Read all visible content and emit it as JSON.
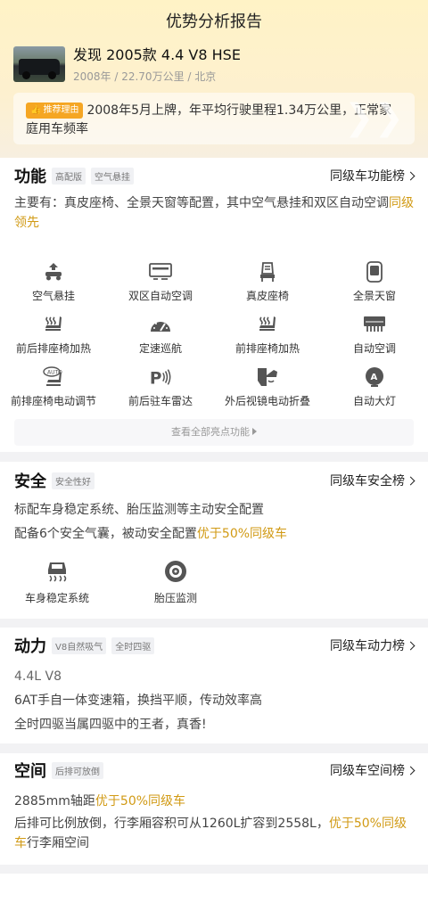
{
  "header": {
    "title": "优势分析报告"
  },
  "car": {
    "name": "发现 2005款 4.4 V8 HSE",
    "sub": "2008年 / 22.70万公里 / 北京"
  },
  "reason": {
    "badge": "推荐理由",
    "text": "2008年5月上牌，年平均行驶里程1.34万公里，正常家庭用车频率"
  },
  "function": {
    "title": "功能",
    "tags": [
      "高配版",
      "空气悬挂"
    ],
    "link": "同级车功能榜",
    "desc_main": "主要有：真皮座椅、全景天窗等配置，其中空气悬挂和双区自动空调",
    "desc_hl": "同级领先",
    "features": [
      {
        "icon": "air-suspension-icon",
        "label": "空气悬挂"
      },
      {
        "icon": "dual-zone-ac-icon",
        "label": "双区自动空调"
      },
      {
        "icon": "leather-seat-icon",
        "label": "真皮座椅"
      },
      {
        "icon": "panoramic-sunroof-icon",
        "label": "全景天窗"
      },
      {
        "icon": "seat-heating-icon",
        "label": "前后排座椅加热"
      },
      {
        "icon": "cruise-control-icon",
        "label": "定速巡航"
      },
      {
        "icon": "seat-heating-icon",
        "label": "前排座椅加热"
      },
      {
        "icon": "auto-ac-icon",
        "label": "自动空调"
      },
      {
        "icon": "power-seat-icon",
        "label": "前排座椅电动调节"
      },
      {
        "icon": "parking-radar-icon",
        "label": "前后驻车雷达"
      },
      {
        "icon": "folding-mirror-icon",
        "label": "外后视镜电动折叠"
      },
      {
        "icon": "auto-headlight-icon",
        "label": "自动大灯"
      }
    ],
    "more": "查看全部亮点功能"
  },
  "safety": {
    "title": "安全",
    "tags": [
      "安全性好"
    ],
    "link": "同级车安全榜",
    "line1": "标配车身稳定系统、胎压监测等主动安全配置",
    "line2_main": "配备6个安全气囊，被动安全配置",
    "line2_hl": "优于50%同级车",
    "features": [
      {
        "icon": "stability-control-icon",
        "label": "车身稳定系统"
      },
      {
        "icon": "tire-pressure-icon",
        "label": "胎压监测"
      }
    ]
  },
  "power": {
    "title": "动力",
    "tags": [
      "V8自然吸气",
      "全时四驱"
    ],
    "link": "同级车动力榜",
    "lines": [
      "4.4L V8",
      "6AT手自一体变速箱，换挡平顺，传动效率高",
      "全时四驱当属四驱中的王者，真香!"
    ]
  },
  "space": {
    "title": "空间",
    "tags": [
      "后排可放倒"
    ],
    "link": "同级车空间榜",
    "line1_main": "2885mm轴距",
    "line1_hl": "优于50%同级车",
    "line2_main": "后排可比例放倒，行李厢容积可从1260L扩容到2558L，",
    "line2_hl": "优于50%同级车",
    "line2_tail": "行李厢空间"
  }
}
